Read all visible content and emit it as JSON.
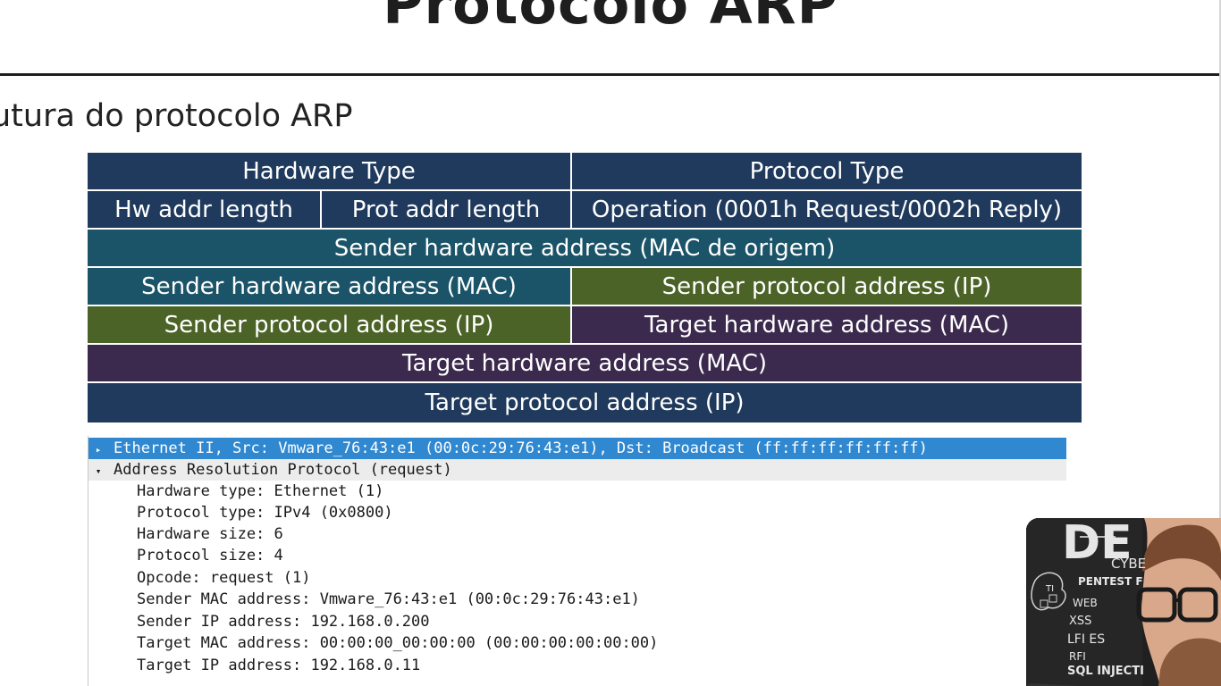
{
  "slide": {
    "title": "Protocolo ARP",
    "subtitle": "utura do protocolo ARP"
  },
  "arp_table": {
    "rows": [
      [
        {
          "text": "Hardware Type",
          "color": "navy"
        },
        {
          "text": "Protocol Type",
          "color": "navy"
        }
      ],
      [
        {
          "text": "Hw addr length",
          "color": "navy"
        },
        {
          "text": "Prot addr length",
          "color": "navy"
        },
        {
          "text": "Operation (0001h Request/0002h Reply)",
          "color": "navy"
        }
      ],
      [
        {
          "text": "Sender hardware address (MAC de origem)",
          "color": "teal"
        }
      ],
      [
        {
          "text": "Sender hardware address (MAC)",
          "color": "teal"
        },
        {
          "text": "Sender protocol address (IP)",
          "color": "olive"
        }
      ],
      [
        {
          "text": "Sender protocol address (IP)",
          "color": "olive"
        },
        {
          "text": "Target hardware address (MAC)",
          "color": "purple"
        }
      ],
      [
        {
          "text": "Target hardware address (MAC)",
          "color": "purple"
        }
      ],
      [
        {
          "text": "Target protocol address (IP)",
          "color": "navy"
        }
      ]
    ],
    "colors": {
      "navy": "#1f3a5c",
      "teal": "#1b5468",
      "olive": "#4c6327",
      "purple": "#3b2a4d"
    }
  },
  "packet_details": {
    "ethernet_line": "Ethernet II, Src: Vmware_76:43:e1 (00:0c:29:76:43:e1), Dst: Broadcast (ff:ff:ff:ff:ff:ff)",
    "arp_line": "Address Resolution Protocol (request)",
    "fields": [
      "Hardware type: Ethernet (1)",
      "Protocol type: IPv4 (0x0800)",
      "Hardware size: 6",
      "Protocol size: 4",
      "Opcode: request (1)",
      "Sender MAC address: Vmware_76:43:e1 (00:0c:29:76:43:e1)",
      "Sender IP address: 192.168.0.200",
      "Target MAC address: 00:00:00_00:00:00 (00:00:00:00:00:00)",
      "Target IP address: 192.168.0.11"
    ],
    "selection_color": "#2f88d0"
  },
  "webcam": {
    "board_lines": [
      "DE",
      "CYBE",
      "PENTEST F",
      "WEB",
      "XSS",
      "LFI ES",
      "RFI",
      "SQL INJECTI",
      "TI"
    ]
  }
}
